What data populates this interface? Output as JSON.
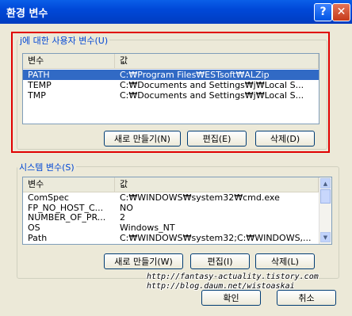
{
  "window": {
    "title": "환경 변수",
    "help": "?",
    "close": "✕"
  },
  "user_group": {
    "label": "j에 대한 사용자 변수(U)",
    "headers": [
      "변수",
      "값"
    ],
    "rows": [
      {
        "name": "PATH",
        "value": "C:₩Program Files₩ESTsoft₩ALZip",
        "selected": true
      },
      {
        "name": "TEMP",
        "value": "C:₩Documents and Settings₩j₩Local S..."
      },
      {
        "name": "TMP",
        "value": "C:₩Documents and Settings₩j₩Local S..."
      }
    ],
    "buttons": {
      "new": "새로 만들기(N)",
      "edit": "편집(E)",
      "delete": "삭제(D)"
    }
  },
  "system_group": {
    "label": "시스템 변수(S)",
    "headers": [
      "변수",
      "값"
    ],
    "rows": [
      {
        "name": "ComSpec",
        "value": "C:₩WINDOWS₩system32₩cmd.exe"
      },
      {
        "name": "FP_NO_HOST_C...",
        "value": "NO"
      },
      {
        "name": "NUMBER_OF_PR...",
        "value": "2"
      },
      {
        "name": "OS",
        "value": "Windows_NT"
      },
      {
        "name": "Path",
        "value": "C:₩WINDOWS₩system32;C:₩WINDOWS,..."
      }
    ],
    "buttons": {
      "new": "새로 만들기(W)",
      "edit": "편집(I)",
      "delete": "삭제(L)"
    }
  },
  "footer": {
    "ok": "확인",
    "cancel": "취소"
  },
  "watermark": [
    "http://fantasy-actuality.tistory.com",
    "http://blog.daum.net/wistoaskai"
  ]
}
